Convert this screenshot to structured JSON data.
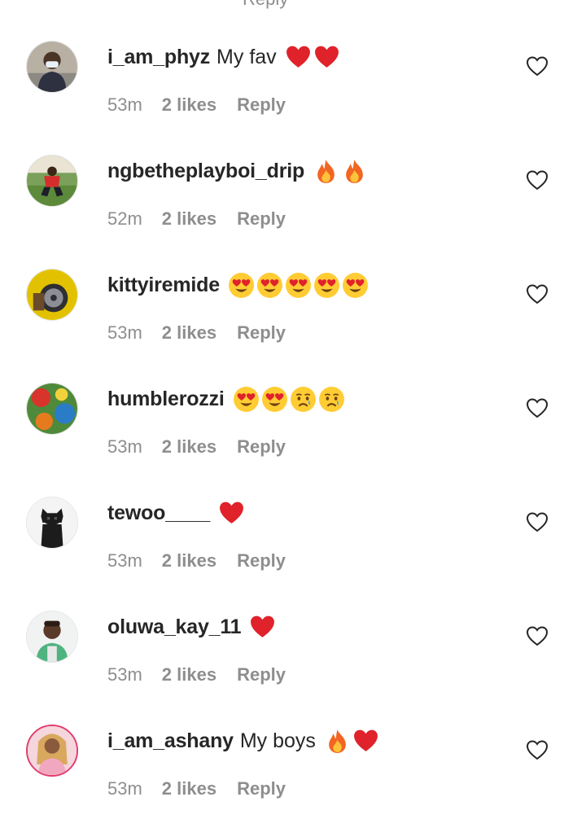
{
  "partial_top_label": "Reply",
  "comments": [
    {
      "username": "i_am_phyz",
      "text": "My fav",
      "emojis": [
        "red-heart",
        "red-heart"
      ],
      "time": "53m",
      "likes": "2 likes",
      "reply": "Reply"
    },
    {
      "username": "ngbetheplayboi_drip",
      "text": "",
      "emojis": [
        "fire",
        "fire"
      ],
      "time": "52m",
      "likes": "2 likes",
      "reply": "Reply"
    },
    {
      "username": "kittyiremide",
      "text": "",
      "emojis": [
        "heart-eyes",
        "heart-eyes",
        "heart-eyes",
        "heart-eyes",
        "heart-eyes"
      ],
      "time": "53m",
      "likes": "2 likes",
      "reply": "Reply"
    },
    {
      "username": "humblerozzi",
      "text": "",
      "emojis": [
        "heart-eyes",
        "heart-eyes",
        "crying-face",
        "crying-face"
      ],
      "time": "53m",
      "likes": "2 likes",
      "reply": "Reply"
    },
    {
      "username": "tewoo____",
      "text": "",
      "emojis": [
        "red-heart"
      ],
      "time": "53m",
      "likes": "2 likes",
      "reply": "Reply"
    },
    {
      "username": "oluwa_kay_11",
      "text": "",
      "emojis": [
        "red-heart"
      ],
      "time": "53m",
      "likes": "2 likes",
      "reply": "Reply"
    },
    {
      "username": "i_am_ashany",
      "text": "My boys",
      "emojis": [
        "fire",
        "red-heart"
      ],
      "time": "53m",
      "likes": "2 likes",
      "reply": "Reply"
    }
  ],
  "icons": {
    "like": "heart-outline-icon"
  },
  "colors": {
    "username": "#262626",
    "meta": "#8e8e8e",
    "heart": "#e0222b"
  }
}
